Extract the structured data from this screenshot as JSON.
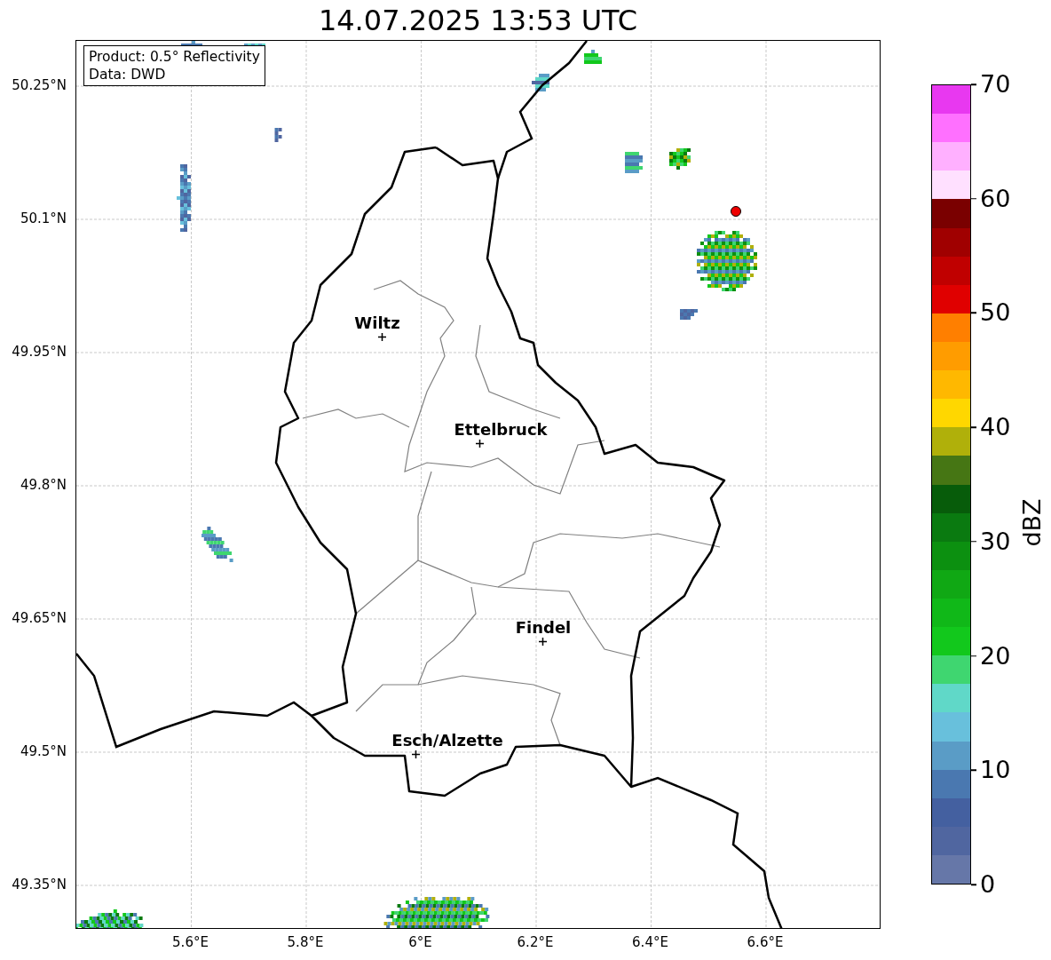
{
  "title": "14.07.2025 13:53 UTC",
  "info_box": {
    "lines": [
      "Product: 0.5° Reflectivity",
      "Data: DWD"
    ]
  },
  "map": {
    "x_ticks": [
      "5.6°E",
      "5.8°E",
      "6°E",
      "6.2°E",
      "6.4°E",
      "6.6°E"
    ],
    "y_ticks": [
      "50.25°N",
      "50.1°N",
      "49.95°N",
      "49.8°N",
      "49.65°N",
      "49.5°N",
      "49.35°N"
    ],
    "cities": [
      {
        "name": "Wiltz"
      },
      {
        "name": "Ettelbruck"
      },
      {
        "name": "Findel"
      },
      {
        "name": "Esch/Alzette"
      }
    ]
  },
  "colorbar": {
    "label": "dBZ",
    "ticks": [
      "70",
      "60",
      "50",
      "40",
      "30",
      "20",
      "10",
      "0"
    ],
    "bands": [
      {
        "color": "#e838f0"
      },
      {
        "color": "#ff70ff"
      },
      {
        "color": "#ffb0ff"
      },
      {
        "color": "#ffe0ff"
      },
      {
        "color": "#7a0000"
      },
      {
        "color": "#a00000"
      },
      {
        "color": "#c00000"
      },
      {
        "color": "#e00000"
      },
      {
        "color": "#ff7f00"
      },
      {
        "color": "#ff9c00"
      },
      {
        "color": "#ffb800"
      },
      {
        "color": "#ffd700"
      },
      {
        "color": "#b0b00a"
      },
      {
        "color": "#467614"
      },
      {
        "color": "#075c0a"
      },
      {
        "color": "#0a7a10"
      },
      {
        "color": "#0c9010"
      },
      {
        "color": "#10a814"
      },
      {
        "color": "#10b818"
      },
      {
        "color": "#12c81c"
      },
      {
        "color": "#3fd670"
      },
      {
        "color": "#60d8c8"
      },
      {
        "color": "#68c0dc"
      },
      {
        "color": "#5a9cc6"
      },
      {
        "color": "#4a78b0"
      },
      {
        "color": "#4460a0"
      },
      {
        "color": "#5066a0"
      },
      {
        "color": "#6677a8"
      }
    ]
  }
}
